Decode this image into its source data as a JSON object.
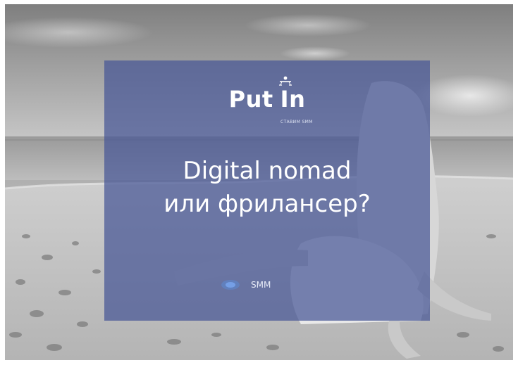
{
  "logo": {
    "word_1": "Put",
    "word_2": "In",
    "tagline": "СТАВИМ SMM",
    "icon": "person-figure-icon"
  },
  "headline": {
    "line_1": "Digital nomad",
    "line_2": "или фрилансер?"
  },
  "category": {
    "label": "SMM",
    "icon": "blue-glow-icon"
  },
  "colors": {
    "overlay": "#46569a",
    "text": "#ffffff"
  }
}
